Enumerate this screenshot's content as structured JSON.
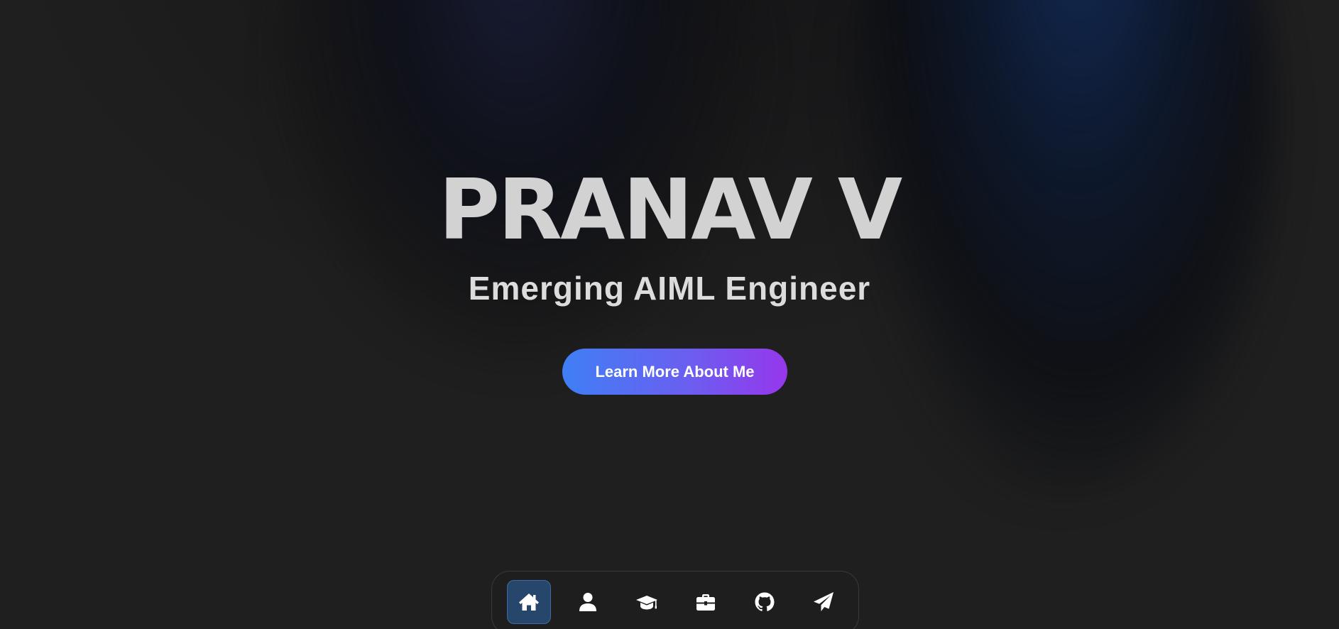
{
  "hero": {
    "name": "PRANAV V",
    "subtitle": "Emerging AIML Engineer",
    "cta_label": "Learn More About Me"
  },
  "dock": {
    "items": [
      {
        "icon": "home-icon",
        "active": true
      },
      {
        "icon": "user-icon",
        "active": false
      },
      {
        "icon": "graduation-cap-icon",
        "active": false
      },
      {
        "icon": "briefcase-icon",
        "active": false
      },
      {
        "icon": "github-icon",
        "active": false
      },
      {
        "icon": "paper-plane-icon",
        "active": false
      }
    ]
  },
  "colors": {
    "background": "#1f1f1f",
    "name_text": "#d2d2d2",
    "cta_gradient_start": "#3f7ff5",
    "cta_gradient_end": "#9637ec",
    "dock_active": "#27466b"
  }
}
